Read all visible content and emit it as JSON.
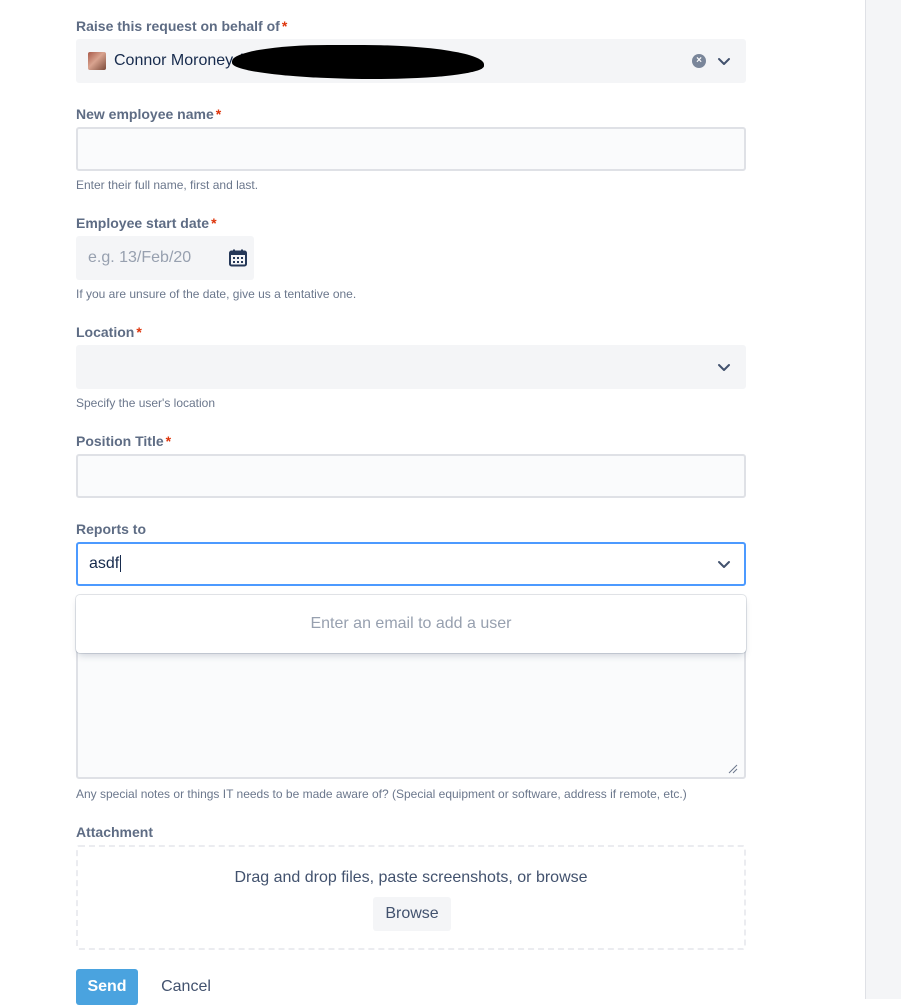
{
  "colors": {
    "required": "#de350b",
    "focus_border": "#4c9aff",
    "primary_button": "#4aa3df"
  },
  "fields": {
    "on_behalf": {
      "label": "Raise this request on behalf of",
      "required": "*",
      "value": "Connor Moroney  (cmoroney@gocloudwave.com)"
    },
    "employee_name": {
      "label": "New employee name",
      "required": "*",
      "help": "Enter their full name, first and last."
    },
    "start_date": {
      "label": "Employee start date",
      "required": "*",
      "placeholder": "e.g. 13/Feb/20",
      "help": "If you are unsure of the date, give us a tentative one."
    },
    "location": {
      "label": "Location",
      "required": "*",
      "help": "Specify the user's location"
    },
    "position_title": {
      "label": "Position Title",
      "required": "*"
    },
    "reports_to": {
      "label": "Reports to",
      "value": "asdf",
      "menu_message": "Enter an email to add a user"
    },
    "notes": {
      "help": "Any special notes or things IT needs to be made aware of? (Special equipment or software, address if remote, etc.)"
    },
    "attachment": {
      "label": "Attachment",
      "drop_text": "Drag and drop files, paste screenshots, or browse",
      "browse_label": "Browse"
    }
  },
  "actions": {
    "send_label": "Send",
    "cancel_label": "Cancel"
  }
}
